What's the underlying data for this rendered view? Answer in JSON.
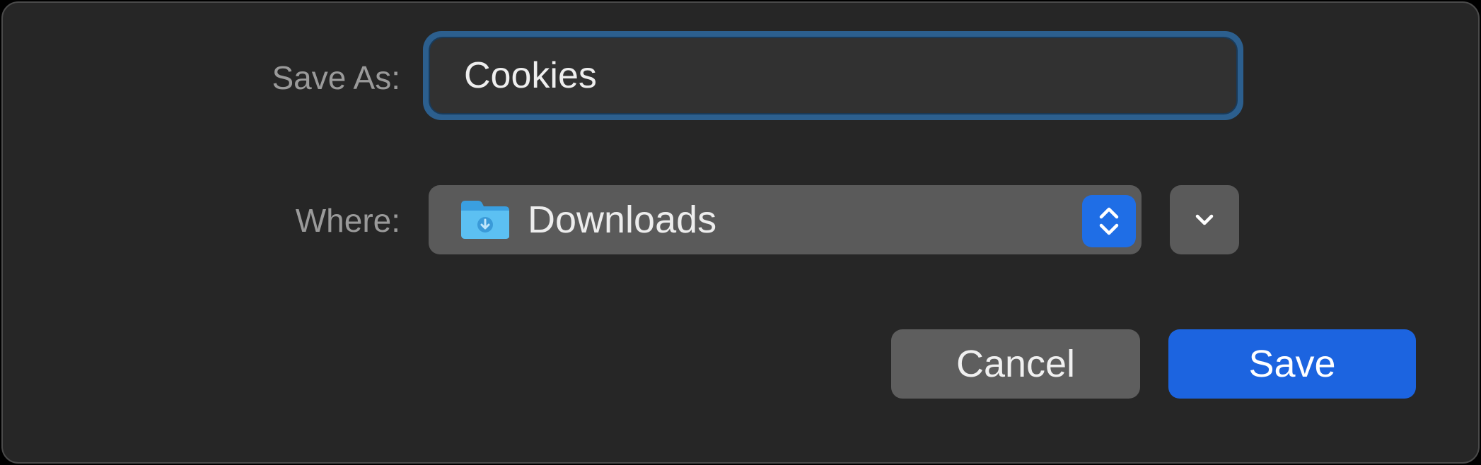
{
  "dialog": {
    "save_as_label": "Save As:",
    "file_name_value": "Cookies",
    "where_label": "Where:",
    "location_value": "Downloads",
    "cancel_label": "Cancel",
    "save_label": "Save"
  },
  "icons": {
    "folder": "downloads-folder-icon",
    "stepper": "up-down-chevron-icon",
    "expand": "chevron-down-icon"
  },
  "colors": {
    "accent": "#1c64e0",
    "focus_ring": "#2c5f8e",
    "background": "#262626",
    "control": "#5a5a5a",
    "folder": "#4fb3ea"
  }
}
